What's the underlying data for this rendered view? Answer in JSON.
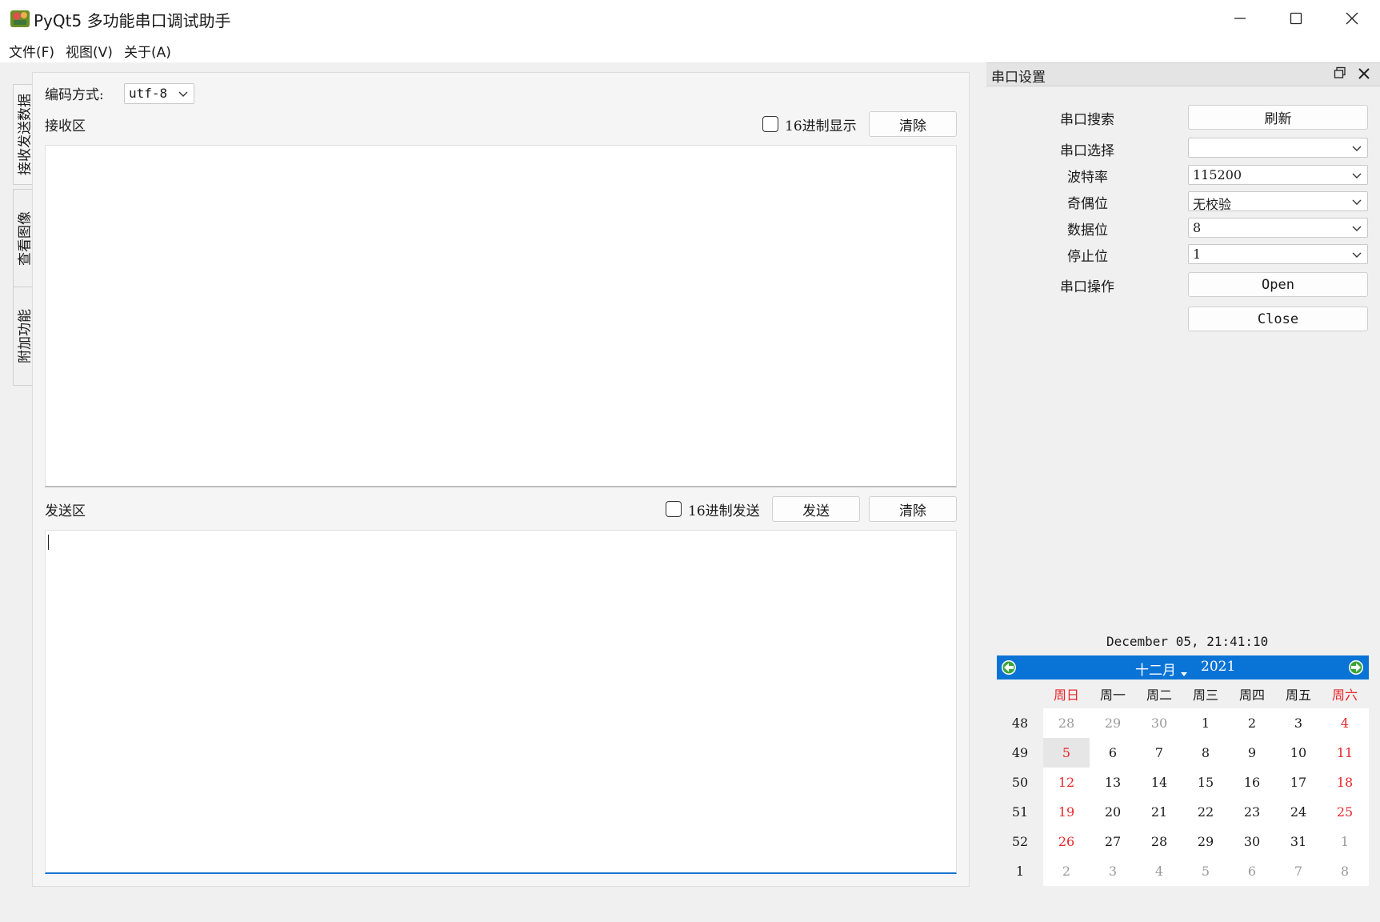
{
  "window": {
    "title": "PyQt5 多功能串口调试助手",
    "controls": [
      "minimize",
      "maximize",
      "close"
    ]
  },
  "menu": {
    "items": [
      "文件(F)",
      "视图(V)",
      "关于(A)"
    ]
  },
  "tabs": [
    "接收发送数据",
    "查看图像",
    "附加功能"
  ],
  "encoding": {
    "label": "编码方式:",
    "value": "utf-8"
  },
  "receive": {
    "label": "接收区",
    "hex_display_label": "16进制显示",
    "hex_display_checked": false,
    "clear_label": "清除"
  },
  "send": {
    "label": "发送区",
    "hex_send_label": "16进制发送",
    "hex_send_checked": false,
    "send_label": "发送",
    "clear_label": "清除"
  },
  "serial": {
    "dock_title": "串口设置",
    "search_label": "串口搜索",
    "refresh_label": "刷新",
    "port_label": "串口选择",
    "port_value": "",
    "baud_label": "波特率",
    "baud_value": "115200",
    "parity_label": "奇偶位",
    "parity_value": "无校验",
    "databits_label": "数据位",
    "databits_value": "8",
    "stopbits_label": "停止位",
    "stopbits_value": "1",
    "operation_label": "串口操作",
    "open_label": "Open",
    "close_label": "Close"
  },
  "clock": {
    "text": "December 05, 21:41:10"
  },
  "calendar": {
    "month": "十二月",
    "year": "2021",
    "weekdays": [
      "周日",
      "周一",
      "周二",
      "周三",
      "周四",
      "周五",
      "周六"
    ],
    "selected_day": "5",
    "weeks": [
      {
        "num": "48",
        "days": [
          "28",
          "29",
          "30",
          "1",
          "2",
          "3",
          "4"
        ]
      },
      {
        "num": "49",
        "days": [
          "5",
          "6",
          "7",
          "8",
          "9",
          "10",
          "11"
        ]
      },
      {
        "num": "50",
        "days": [
          "12",
          "13",
          "14",
          "15",
          "16",
          "17",
          "18"
        ]
      },
      {
        "num": "51",
        "days": [
          "19",
          "20",
          "21",
          "22",
          "23",
          "24",
          "25"
        ]
      },
      {
        "num": "52",
        "days": [
          "26",
          "27",
          "28",
          "29",
          "30",
          "31",
          "1"
        ]
      },
      {
        "num": "1",
        "days": [
          "2",
          "3",
          "4",
          "5",
          "6",
          "7",
          "8"
        ]
      }
    ],
    "colors": {
      "header": "#0a74d6",
      "weekend": "#e8262a",
      "other_month": "#9a9a9a"
    }
  }
}
